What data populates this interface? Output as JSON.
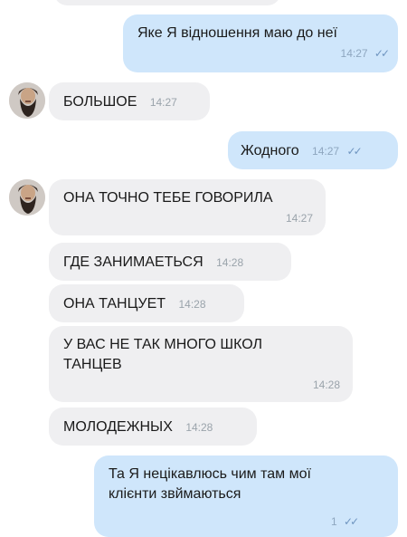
{
  "messages": [
    {
      "text": "Яке Я відношення маю до неї",
      "time": "14:27"
    },
    {
      "text": "БОЛЬШОЕ",
      "time": "14:27"
    },
    {
      "text": "Жодного",
      "time": "14:27"
    },
    {
      "text": "ОНА ТОЧНО ТЕБЕ ГОВОРИЛА",
      "time": "14:27"
    },
    {
      "text": "ГДЕ ЗАНИМАЕТЬСЯ",
      "time": "14:28"
    },
    {
      "text": "ОНА ТАНЦУЕТ",
      "time": "14:28"
    },
    {
      "text": "У ВАС НЕ ТАК МНОГО ШКОЛ ТАНЦЕВ",
      "time": "14:28"
    },
    {
      "text": "МОЛОДЕЖНЫХ",
      "time": "14:28"
    },
    {
      "text": "Та Я нецікавлюсь чим там мої клієнти звймаються",
      "time": "1"
    }
  ],
  "colors": {
    "incoming_bubble": "#efeff1",
    "outgoing_bubble": "#cfe6fb",
    "timestamp": "#9aa3ab",
    "read_ticks": "#6f95c0"
  },
  "icons": {
    "read_receipt": "double-check-icon",
    "avatar": "bearded-man-avatar"
  }
}
